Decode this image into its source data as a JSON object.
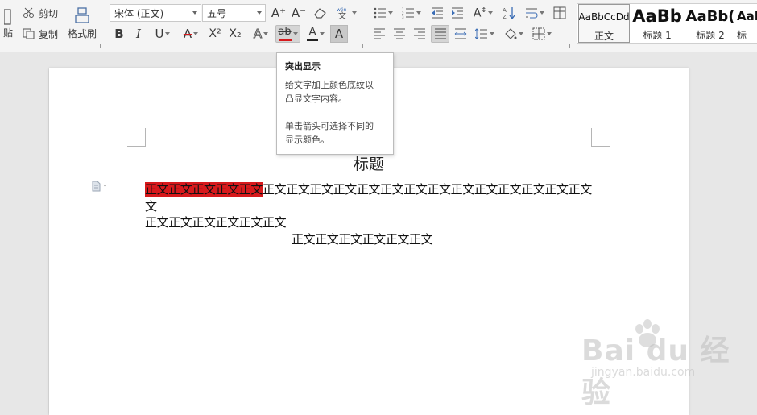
{
  "clipboard": {
    "paste_label": "贴",
    "cut_label": "剪切",
    "copy_label": "复制",
    "format_painter_label": "格式刷"
  },
  "font": {
    "family_value": "宋体 (正文)",
    "size_value": "五号",
    "increase_icon": "A⁺",
    "decrease_icon": "A⁻",
    "bold": "B",
    "italic": "I",
    "underline": "U",
    "strikethrough": "A",
    "superscript": "X²",
    "subscript": "X₂",
    "text_effect": "A",
    "highlight": "ab",
    "font_color": "A",
    "char_shading": "A",
    "highlight_color": "#d7191c"
  },
  "styles": {
    "items": [
      {
        "preview": "AaBbCcDd",
        "name": "正文"
      },
      {
        "preview": "AaBb",
        "name": "标题 1"
      },
      {
        "preview": "AaBb(",
        "name": "标题 2"
      },
      {
        "preview": "AaI",
        "name": "标"
      }
    ]
  },
  "tooltip": {
    "title": "突出显示",
    "line1": "给文字加上颜色底纹以",
    "line2": "凸显文字内容。",
    "line3": "单击箭头可选择不同的",
    "line4": "显示颜色。"
  },
  "document": {
    "title": "标题",
    "highlighted_text": "正文正文正文正文正文",
    "line1_rest": "正文正文正文正文正文正文正文正文正文正文正文正文正文正文",
    "line1_wrap": "文",
    "line2": "正文正文正文正文正文正文",
    "line3": "正文正文正文正文正文正文"
  },
  "watermark": {
    "brand": "Bai du 经验",
    "url": "jingyan.baidu.com"
  }
}
